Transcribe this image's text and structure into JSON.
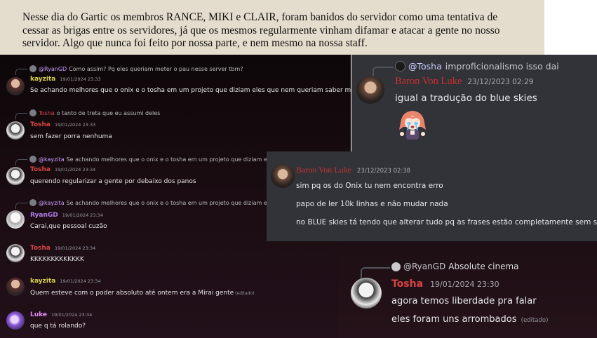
{
  "document": {
    "paragraph": "Nesse dia do Gartic os membros RANCE, MIKI e CLAIR, foram banidos do servidor como uma tentativa de cessar as brigas entre os servidores, já que os mesmos regularmente vinham difamar e atacar a gente no nosso servidor. Algo que nunca foi feito por nossa parte, e nem mesmo na nossa staff."
  },
  "chat": {
    "messages": [
      {
        "reply_mention": "@RyanGD",
        "reply_text": "Como assim? Pq eles queriam meter o pau nesse server tbm?",
        "author": "kayzita",
        "time": "19/01/2024 23:33",
        "text": "Se achando melhores que o onix e o tosha em um projeto que diziam eles que nem queriam saber mais",
        "edited": ""
      },
      {
        "reply_mention": "Tosha",
        "reply_text": "o tanto de treta que eu assumi deles",
        "author": "Tosha",
        "time": "19/01/2024 23:33",
        "text": "sem fazer porra nenhuma",
        "edited": ""
      },
      {
        "reply_mention": "@kayzita",
        "reply_text": "Se achando melhores que o onix e o tosha em um projeto que diziam eles que nem queriam saber mais",
        "author": "Tosha",
        "time": "19/01/2024 23:34",
        "text": "querendo regularizar a gente por debaixo dos panos",
        "edited": ""
      },
      {
        "reply_mention": "@kayzita",
        "reply_text": "Se achando melhores que o onix e o tosha em um projeto que diziam eles que nem queriam saber mais",
        "author": "RyanGD",
        "time": "19/01/2024 23:34",
        "text": "Carai,que pessoal cuzão",
        "edited": ""
      },
      {
        "author": "Tosha",
        "time": "19/01/2024 23:34",
        "text": "KKKKKKKKKKKKK",
        "edited": ""
      },
      {
        "author": "kayzita",
        "time": "19/01/2024 23:34",
        "text": "Quem esteve com o poder absoluto até ontem era a Mirai gente",
        "edited": "(editado)"
      },
      {
        "author": "Luke",
        "time": "19/01/2024 23:34",
        "text": "que q tá rolando?",
        "edited": ""
      }
    ]
  },
  "panel1": {
    "reply_mention": "@Tosha",
    "reply_text": "improficionalismo isso dai",
    "author": "Baron Von Luke",
    "time": "23/12/2023 02:29",
    "text": "igual a tradução do blue skies"
  },
  "panel2": {
    "author": "Baron Von Luke",
    "time": "23/12/2023 02:38",
    "lines": [
      "sim pq os do Onix tu nem encontra erro",
      "papo de ler 10k linhas e não mudar nada",
      "no BLUE skies tá tendo que alterar tudo pq as frases estão completamente sem sentido"
    ]
  },
  "panel3": {
    "reply_mention": "@RyanGD",
    "reply_text": "Absolute cinema",
    "author": "Tosha",
    "time": "19/01/2024 23:30",
    "line1": "agora temos liberdade pra falar",
    "line2": "eles foram uns arrombados",
    "edited": "(editado)"
  },
  "colors": {
    "kayzita": "#d7d050",
    "tosha": "#d84545",
    "ryangd": "#b07ae8",
    "luke": "#e189ff",
    "baron": "#c93030"
  }
}
